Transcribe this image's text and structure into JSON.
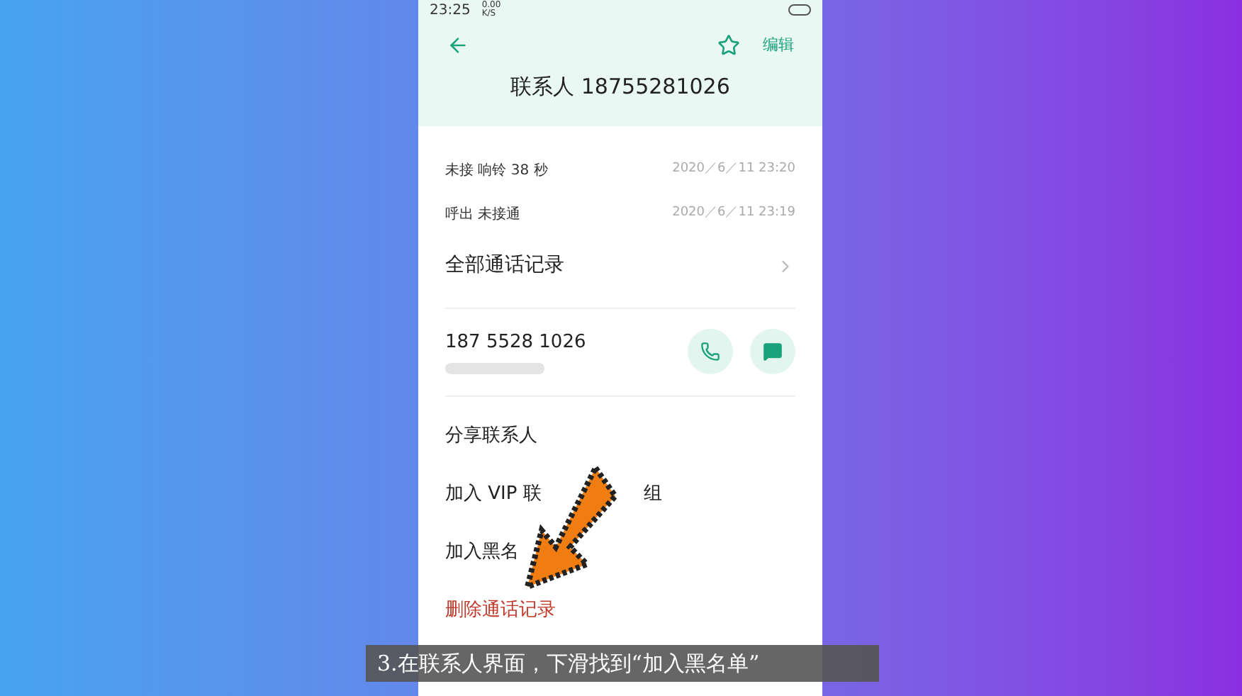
{
  "status_bar": {
    "time": "23:25",
    "network": "0.00 K/S"
  },
  "header": {
    "edit": "编辑",
    "title": "联系人 18755281026",
    "starred": false
  },
  "recent_calls": [
    {
      "label": "未接 响铃 38 秒",
      "time": "2020／6／11 23:20"
    },
    {
      "label": "呼出 未接通",
      "time": "2020／6／11 23:19"
    }
  ],
  "all_calls": "全部通话记录",
  "phone": {
    "number": "187 5528 1026"
  },
  "actions": [
    {
      "kind": "plain",
      "label": "分享联系人"
    },
    {
      "kind": "covered",
      "label": "加入 VIP 联",
      "tail": "组"
    },
    {
      "kind": "plain",
      "label": "加入黑名"
    },
    {
      "kind": "danger",
      "label": "删除通话记录"
    }
  ],
  "caption": "3.在联系人界面，下滑找到“加入黑名单”"
}
